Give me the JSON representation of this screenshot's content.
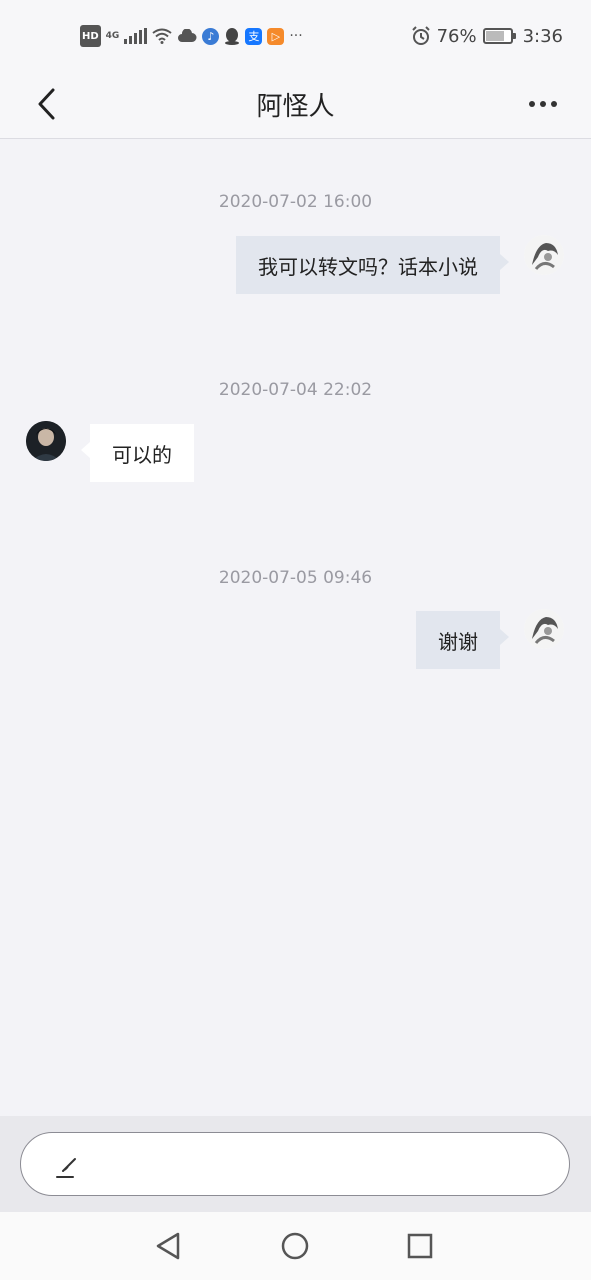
{
  "status_bar": {
    "left_labels": {
      "hd": "HD",
      "network": "4G"
    },
    "battery_percent": "76%",
    "time": "3:36",
    "icons": [
      "signal-icon",
      "wifi-icon",
      "cloud-icon",
      "music-icon",
      "qq-icon",
      "alipay-icon",
      "video-icon",
      "more-notifications-icon",
      "alarm-icon",
      "battery-icon"
    ]
  },
  "header": {
    "title": "阿怪人"
  },
  "messages": [
    {
      "timestamp": "2020-07-02 16:00",
      "sender": "self",
      "text": "我可以转文吗？话本小说"
    },
    {
      "timestamp": "2020-07-04 22:02",
      "sender": "other",
      "text": "可以的"
    },
    {
      "timestamp": "2020-07-05 09:46",
      "sender": "self",
      "text": "谢谢"
    }
  ],
  "input": {
    "placeholder": ""
  },
  "colors": {
    "background": "#f3f3f7",
    "bubble_self": "#e2e6ee",
    "bubble_other": "#ffffff",
    "timestamp": "#9a9aa2"
  }
}
